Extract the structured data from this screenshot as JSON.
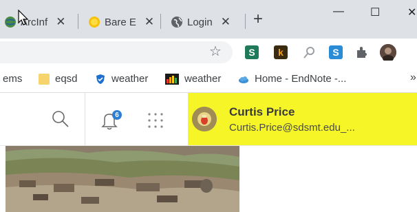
{
  "tabs": [
    {
      "label": "ArcInf",
      "close": "✕"
    },
    {
      "label": "Bare E",
      "close": "✕"
    },
    {
      "label": "Login",
      "close": "✕"
    }
  ],
  "newtab": "+",
  "window": {
    "minimize": "—",
    "maximize": "☐",
    "close": "✕"
  },
  "toolbar": {
    "star": "☆",
    "ext_s": "S",
    "ext_k": "k",
    "ext_s2": "S",
    "menu": "⋮"
  },
  "bookmarks": [
    {
      "label": "ems"
    },
    {
      "label": "eqsd"
    },
    {
      "label": "weather"
    },
    {
      "label": "weather"
    },
    {
      "label": "Home - EndNote -..."
    }
  ],
  "bookmarks_more": "»",
  "notifications": {
    "count": "6"
  },
  "user": {
    "name": "Curtis Price",
    "email": "Curtis.Price@sdsmt.edu_..."
  },
  "colors": {
    "user_card_bg": "#f5f528",
    "badge": "#2d7fd4"
  }
}
